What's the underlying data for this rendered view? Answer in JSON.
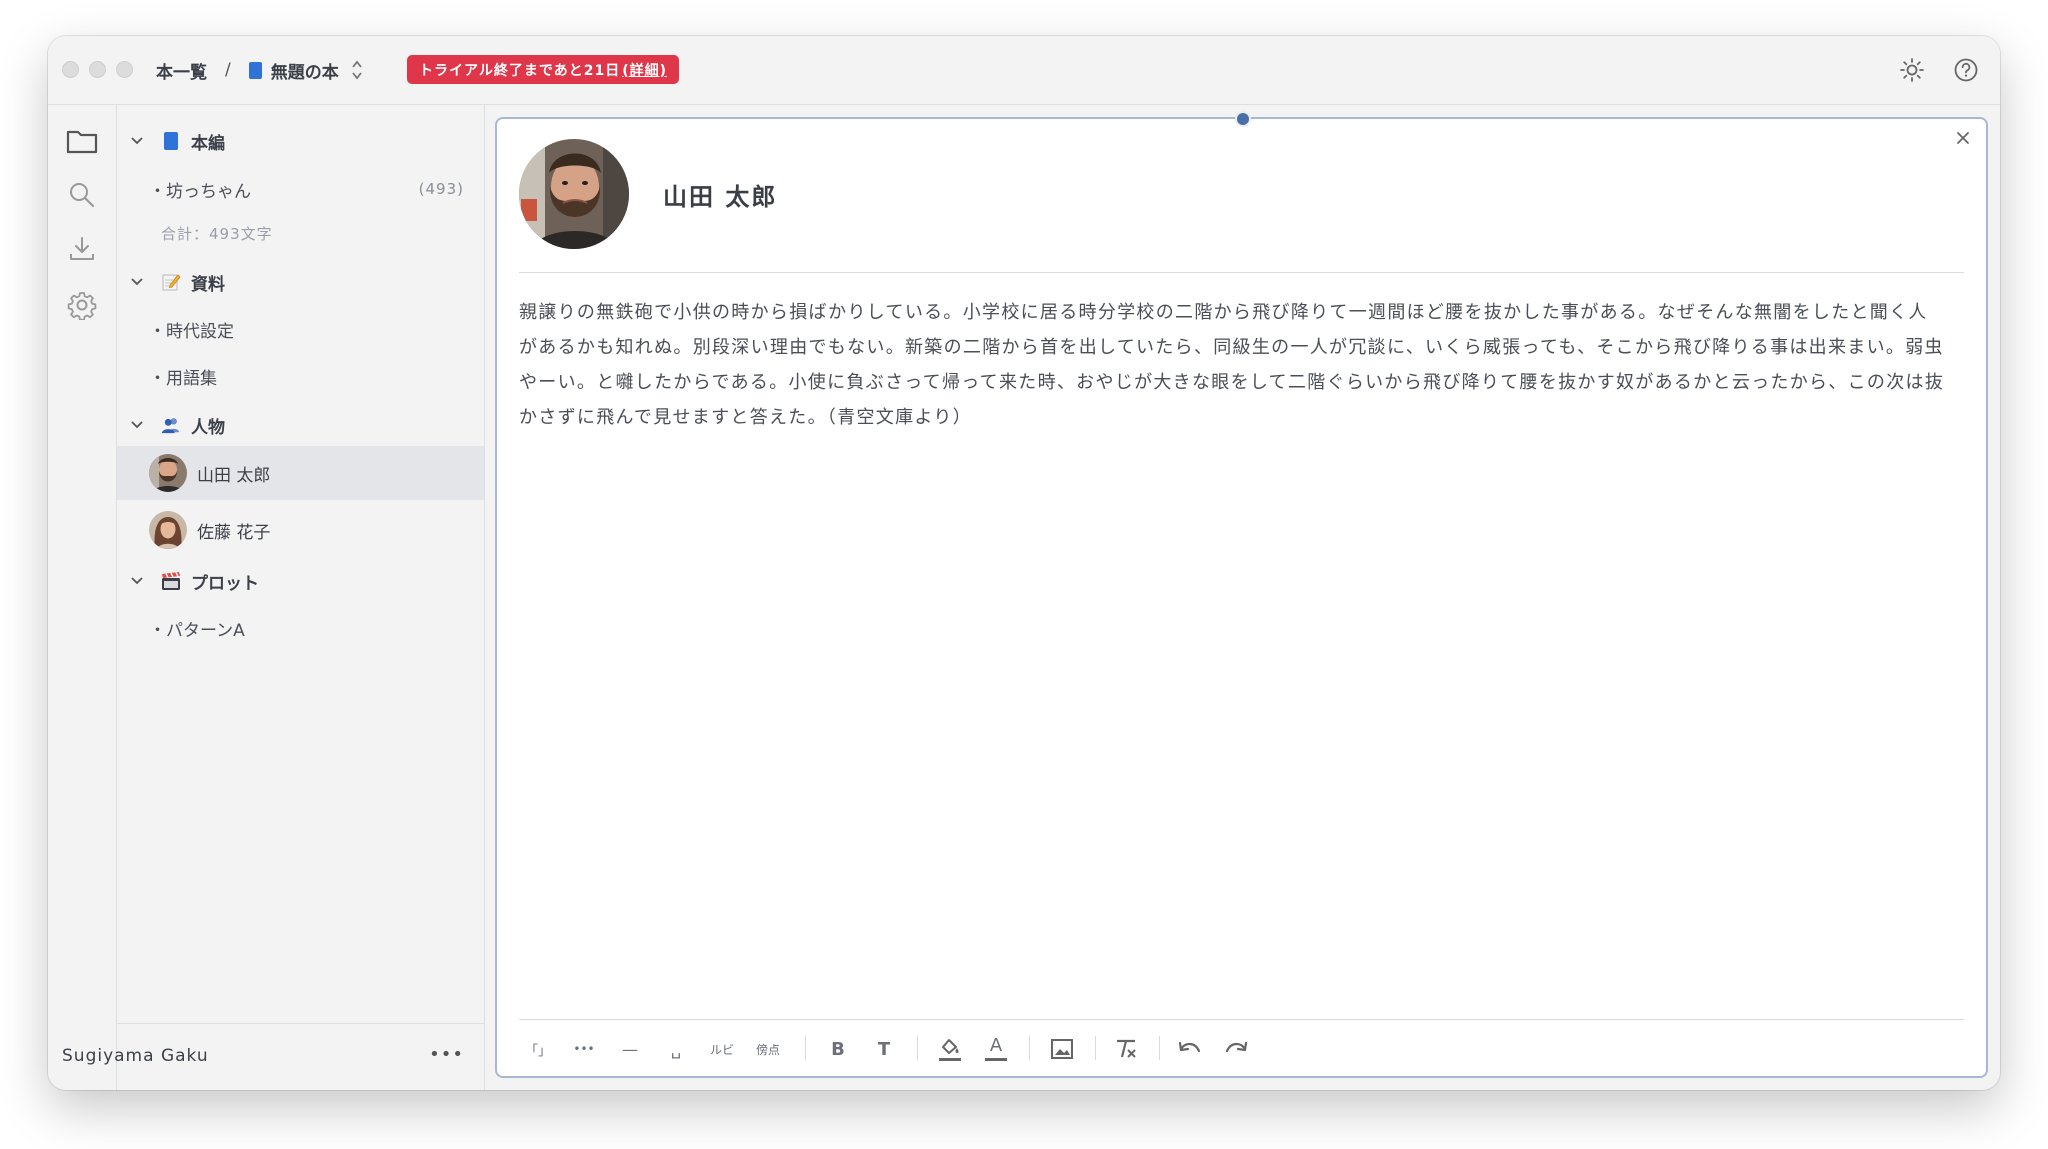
{
  "titlebar": {
    "breadcrumb_root": "本一覧",
    "breadcrumb_sep": "/",
    "breadcrumb_book": "無題の本",
    "trial_text": "トライアル終了まであと21日",
    "trial_link": "(詳細)"
  },
  "tree": {
    "group_honpen": "本編",
    "item_botchan": "・坊っちゃん",
    "item_botchan_count": "(493)",
    "honpen_total": "合計：493文字",
    "group_shiryo": "資料",
    "item_jidai": "・時代設定",
    "item_yougo": "・用語集",
    "group_jinbutsu": "人物",
    "person_1": "山田 太郎",
    "person_2": "佐藤 花子",
    "group_plot": "プロット",
    "item_pattern": "・パターンA"
  },
  "footer": {
    "user_name": "Sugiyama Gaku",
    "more_label": "•••"
  },
  "editor": {
    "character_name": "山田 太郎",
    "body": "親譲りの無鉄砲で小供の時から損ばかりしている。小学校に居る時分学校の二階から飛び降りて一週間ほど腰を抜かした事がある。なぜそんな無闇をしたと聞く人があるかも知れぬ。別段深い理由でもない。新築の二階から首を出していたら、同級生の一人が冗談に、いくら威張っても、そこから飛び降りる事は出来まい。弱虫やーい。と囃したからである。小使に負ぶさって帰って来た時、おやじが大きな眼をして二階ぐらいから飛び降りて腰を抜かす奴があるかと云ったから、この次は抜かさずに飛んで見せますと答えた。（青空文庫より）"
  },
  "toolbar": {
    "bracket": "「」",
    "ellipsis": "•••",
    "dash": "—",
    "space": "␣",
    "ruby": "ルビ",
    "emphasis": "傍点",
    "bold": "B",
    "text_size": "T",
    "highlight": "highlight-icon",
    "font_color": "A",
    "image": "image-icon",
    "clear_format": "clear-format-icon",
    "undo": "undo-icon",
    "redo": "redo-icon"
  },
  "colors": {
    "trial_badge": "#e0364a",
    "book_icon": "#2f73d9",
    "editor_border": "#a8b8d4",
    "handle": "#4a6fa5",
    "selected_row": "#e4e5e8"
  }
}
